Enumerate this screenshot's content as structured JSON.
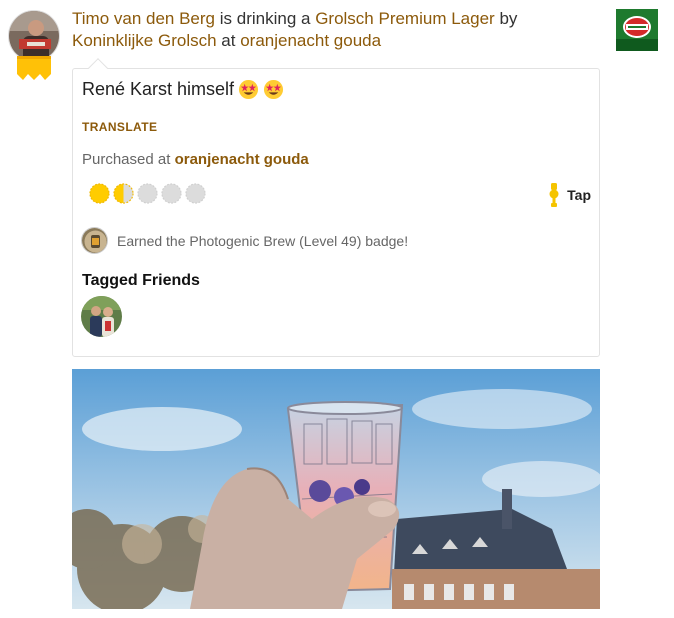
{
  "checkin": {
    "user_name": "Timo van den Berg",
    "is_drinking": "is drinking a",
    "beer_name": "Grolsch Premium Lager",
    "by": "by",
    "brewery_name": "Koninklijke Grolsch",
    "at": "at",
    "venue_name": "oranjenacht gouda"
  },
  "card": {
    "comment": "René Karst himself",
    "translate_label": "TRANSLATE",
    "purchased_prefix": "Purchased at",
    "purchased_venue": "oranjenacht gouda",
    "rating": 1.5,
    "rating_max": 5,
    "serving_label": "Tap",
    "badge_text": "Earned the Photogenic Brew (Level 49) badge!",
    "tagged_friends_title": "Tagged Friends"
  },
  "icons": {
    "emoji": "star-struck-emoji-icon",
    "rating": "bottle-cap-icon",
    "serving": "tap-icon",
    "brand_logo": "grolsch-logo"
  },
  "colors": {
    "link": "#8c5a0b",
    "cap_filled": "#ffcc00",
    "cap_empty": "#dcdcdc",
    "serving_icon": "#f5c400"
  }
}
